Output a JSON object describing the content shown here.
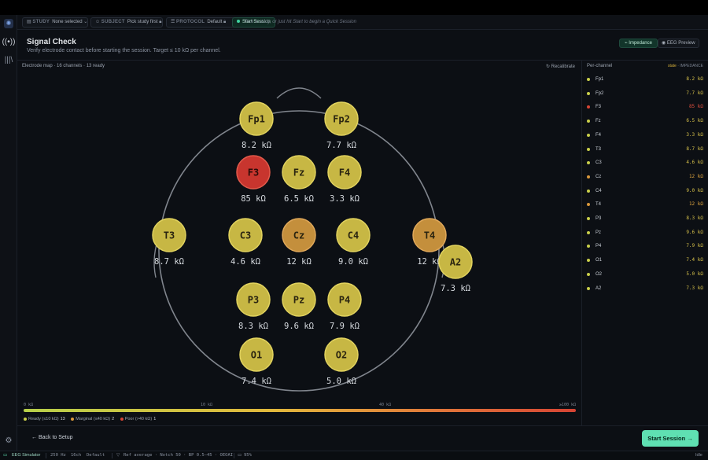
{
  "toolbar": {
    "study_label": "STUDY",
    "study_value": "None selected",
    "subject_label": "SUBJECT",
    "subject_value": "Pick study first",
    "protocol_label": "PROTOCOL",
    "protocol_value": "Default",
    "start_chip": "Start Session",
    "hint": "Pick a study, or just hit Start to begin a Quick Session"
  },
  "header": {
    "title": "Signal Check",
    "subtitle": "Verify electrode contact before starting the session. Target ≤ 10 kΩ per channel.",
    "tab_impedance": "Impedance",
    "tab_eeg": "EEG Preview"
  },
  "map": {
    "label": "Electrode map · 16 channels · 13 ready",
    "recalibrate": "Recalibrate"
  },
  "electrodes": [
    {
      "name": "Fp1",
      "value": "8.2 kΩ",
      "status": "ready"
    },
    {
      "name": "Fp2",
      "value": "7.7 kΩ",
      "status": "ready"
    },
    {
      "name": "F3",
      "value": "85 kΩ",
      "status": "poor"
    },
    {
      "name": "Fz",
      "value": "6.5 kΩ",
      "status": "ready"
    },
    {
      "name": "F4",
      "value": "3.3 kΩ",
      "status": "ready"
    },
    {
      "name": "T3",
      "value": "8.7 kΩ",
      "status": "ready"
    },
    {
      "name": "C3",
      "value": "4.6 kΩ",
      "status": "ready"
    },
    {
      "name": "Cz",
      "value": "12 kΩ",
      "status": "marginal"
    },
    {
      "name": "C4",
      "value": "9.0 kΩ",
      "status": "ready"
    },
    {
      "name": "T4",
      "value": "12 kΩ",
      "status": "marginal"
    },
    {
      "name": "A2",
      "value": "7.3 kΩ",
      "status": "ready"
    },
    {
      "name": "P3",
      "value": "8.3 kΩ",
      "status": "ready"
    },
    {
      "name": "Pz",
      "value": "9.6 kΩ",
      "status": "ready"
    },
    {
      "name": "P4",
      "value": "7.9 kΩ",
      "status": "ready"
    },
    {
      "name": "O1",
      "value": "7.4 kΩ",
      "status": "ready"
    },
    {
      "name": "O2",
      "value": "5.0 kΩ",
      "status": "ready"
    }
  ],
  "scale": {
    "ticks": [
      "0 kΩ",
      "10 kΩ",
      "40 kΩ",
      "≥100 kΩ"
    ],
    "legend_ready": "Ready (≤10 kΩ)",
    "legend_ready_count": "13",
    "legend_marginal": "Marginal (≤40 kΩ)",
    "legend_marginal_count": "2",
    "legend_poor": "Poor (>40 kΩ)",
    "legend_poor_count": "1"
  },
  "side": {
    "title": "Per-channel",
    "col_state": "state",
    "col_sep": "·",
    "col_impedance": "IMPEDANCE",
    "rows": [
      {
        "name": "Fp1",
        "value": "8.2 kΩ",
        "status": "ready"
      },
      {
        "name": "Fp2",
        "value": "7.7 kΩ",
        "status": "ready"
      },
      {
        "name": "F3",
        "value": "85 kΩ",
        "status": "poor"
      },
      {
        "name": "Fz",
        "value": "6.5 kΩ",
        "status": "ready"
      },
      {
        "name": "F4",
        "value": "3.3 kΩ",
        "status": "ready"
      },
      {
        "name": "T3",
        "value": "8.7 kΩ",
        "status": "ready"
      },
      {
        "name": "C3",
        "value": "4.6 kΩ",
        "status": "ready"
      },
      {
        "name": "Cz",
        "value": "12 kΩ",
        "status": "marginal"
      },
      {
        "name": "C4",
        "value": "9.0 kΩ",
        "status": "ready"
      },
      {
        "name": "T4",
        "value": "12 kΩ",
        "status": "marginal"
      },
      {
        "name": "P3",
        "value": "8.3 kΩ",
        "status": "ready"
      },
      {
        "name": "Pz",
        "value": "9.6 kΩ",
        "status": "ready"
      },
      {
        "name": "P4",
        "value": "7.9 kΩ",
        "status": "ready"
      },
      {
        "name": "O1",
        "value": "7.4 kΩ",
        "status": "ready"
      },
      {
        "name": "O2",
        "value": "5.0 kΩ",
        "status": "ready"
      },
      {
        "name": "A2",
        "value": "7.3 kΩ",
        "status": "ready"
      }
    ]
  },
  "footer": {
    "back": "← Back to Setup",
    "start": "Start Session →"
  },
  "statusbar": {
    "device": "EEG Simulator",
    "rate": "250 Hz",
    "channels": "16ch",
    "montage": "Default",
    "filter": "Ref average · Notch 50 · BP 0.5–45 · OEOAI",
    "battery": "95%",
    "state": "Idle"
  },
  "colors": {
    "accent": "#5fe0b2",
    "ready": "#c9cf4a",
    "marginal": "#d9973b",
    "poor": "#d64434"
  },
  "icons": {
    "rail_signal": "signal-icon",
    "rail_library": "library-icon",
    "rail_settings": "gear-icon"
  }
}
